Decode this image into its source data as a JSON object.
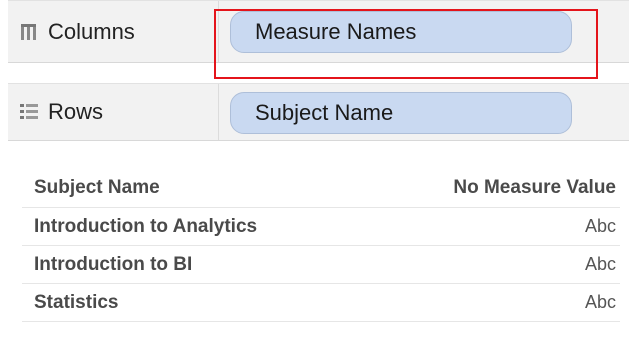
{
  "shelves": {
    "columns": {
      "label": "Columns",
      "icon": "columns-icon",
      "pill": "Measure Names"
    },
    "rows": {
      "label": "Rows",
      "icon": "rows-icon",
      "pill": "Subject Name"
    }
  },
  "highlight_color": "#e4141b",
  "pill_color": "#c9d9f1",
  "table": {
    "headers": [
      "Subject Name",
      "No Measure Value"
    ],
    "rows": [
      [
        "Introduction to Analytics",
        "Abc"
      ],
      [
        "Introduction to BI",
        "Abc"
      ],
      [
        "Statistics",
        "Abc"
      ]
    ]
  }
}
